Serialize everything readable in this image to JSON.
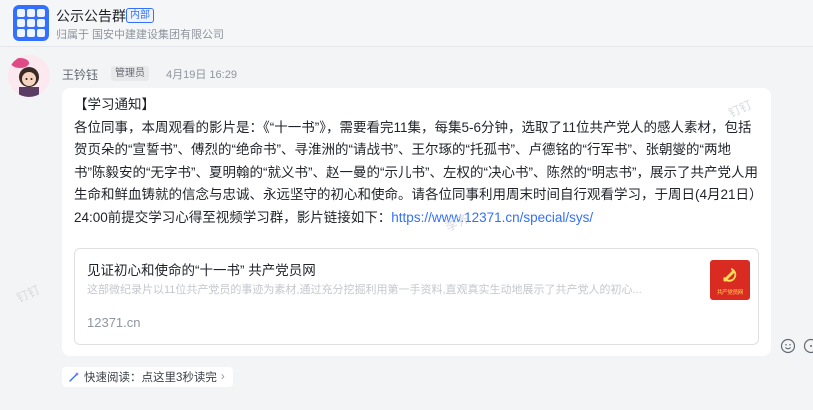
{
  "header": {
    "title": "公示公告群",
    "tag": "内部",
    "subtitle": "归属于 国安中建建设集团有限公司"
  },
  "message": {
    "sender": "王钤钰",
    "role_badge": "管理员",
    "time": "4月19日 16:29",
    "paragraphs": [
      "【学习通知】",
      "各位同事，本周观看的影片是：《“十一书”》，需要看完11集，每集5-6分钟，选取了11位共产党人的感人素材，包括贺页朵的“宣誓书”、傅烈的“绝命书”、寻淮洲的“请战书”、王尔琢的“托孤书”、卢德铭的“行军书”、张朝燮的“两地书”陈毅安的“无字书”、夏明翰的“就义书”、赵一曼的“示儿书”、左权的“决心书”、陈然的“明志书”，展示了共产党人用生命和鲜血铸就的信念与忠诚、永远坚守的初心和使命。请各位同事利用周末时间自行观看学习，于周日(4月21日）24:00前提交学习心得至视频学习群，影片链接如下："
    ],
    "link": "https://www.12371.cn/special/sys/",
    "card": {
      "title": "见证初心和使命的“十一书”  共产党员网",
      "description": "这部微纪录片以11位共产党员的事迹为素材,通过充分挖掘利用第一手资料,直观真实生动地展示了共产党人的初心...",
      "domain": "12371.cn",
      "thumb_text": "共产党员网",
      "thumb_color": "#d92b21"
    }
  },
  "quick_read": {
    "label": "快速阅读：点这里3秒读完",
    "arrow": "›"
  },
  "watermarks": [
    "李齐",
    "钉钉"
  ],
  "colors": {
    "accent": "#3370ff",
    "background": "#f3f4f6"
  }
}
